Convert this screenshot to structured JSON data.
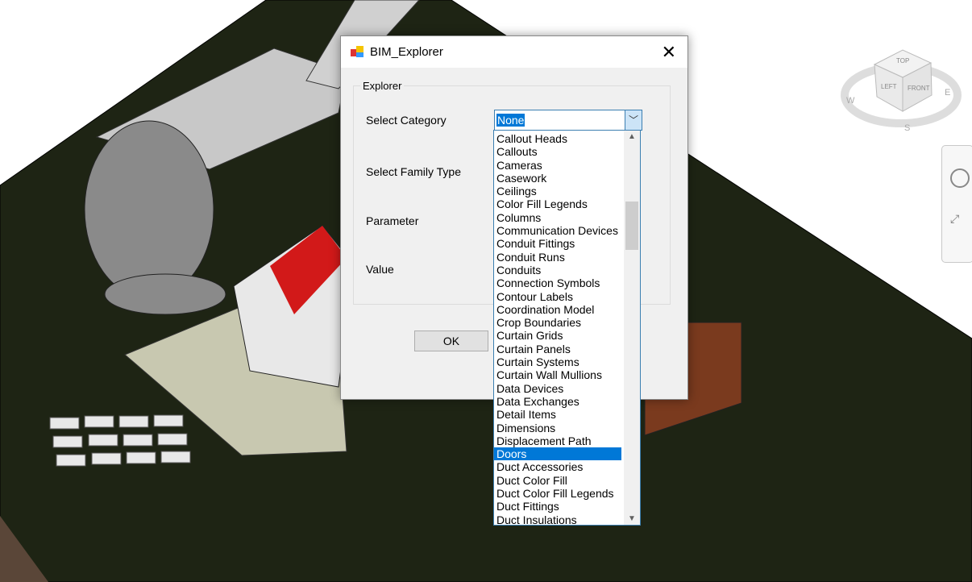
{
  "dialog": {
    "title": "BIM_Explorer",
    "close": "✕",
    "group_label": "Explorer",
    "labels": {
      "category": "Select Category",
      "family_type": "Select Family Type",
      "parameter": "Parameter",
      "value": "Value"
    },
    "category_value": "None",
    "ok_label": "OK"
  },
  "category_list": {
    "items": [
      "Callout Heads",
      "Callouts",
      "Cameras",
      "Casework",
      "Ceilings",
      "Color Fill Legends",
      "Columns",
      "Communication Devices",
      "Conduit Fittings",
      "Conduit Runs",
      "Conduits",
      "Connection Symbols",
      "Contour Labels",
      "Coordination Model",
      "Crop Boundaries",
      "Curtain Grids",
      "Curtain Panels",
      "Curtain Systems",
      "Curtain Wall Mullions",
      "Data Devices",
      "Data Exchanges",
      "Detail Items",
      "Dimensions",
      "Displacement Path",
      "Doors",
      "Duct Accessories",
      "Duct Color Fill",
      "Duct Color Fill Legends",
      "Duct Fittings",
      "Duct Insulations"
    ],
    "selected": "Doors"
  },
  "viewcube": {
    "top": "TOP",
    "left": "LEFT",
    "front": "FRONT",
    "w": "W",
    "e": "E",
    "s": "S"
  }
}
